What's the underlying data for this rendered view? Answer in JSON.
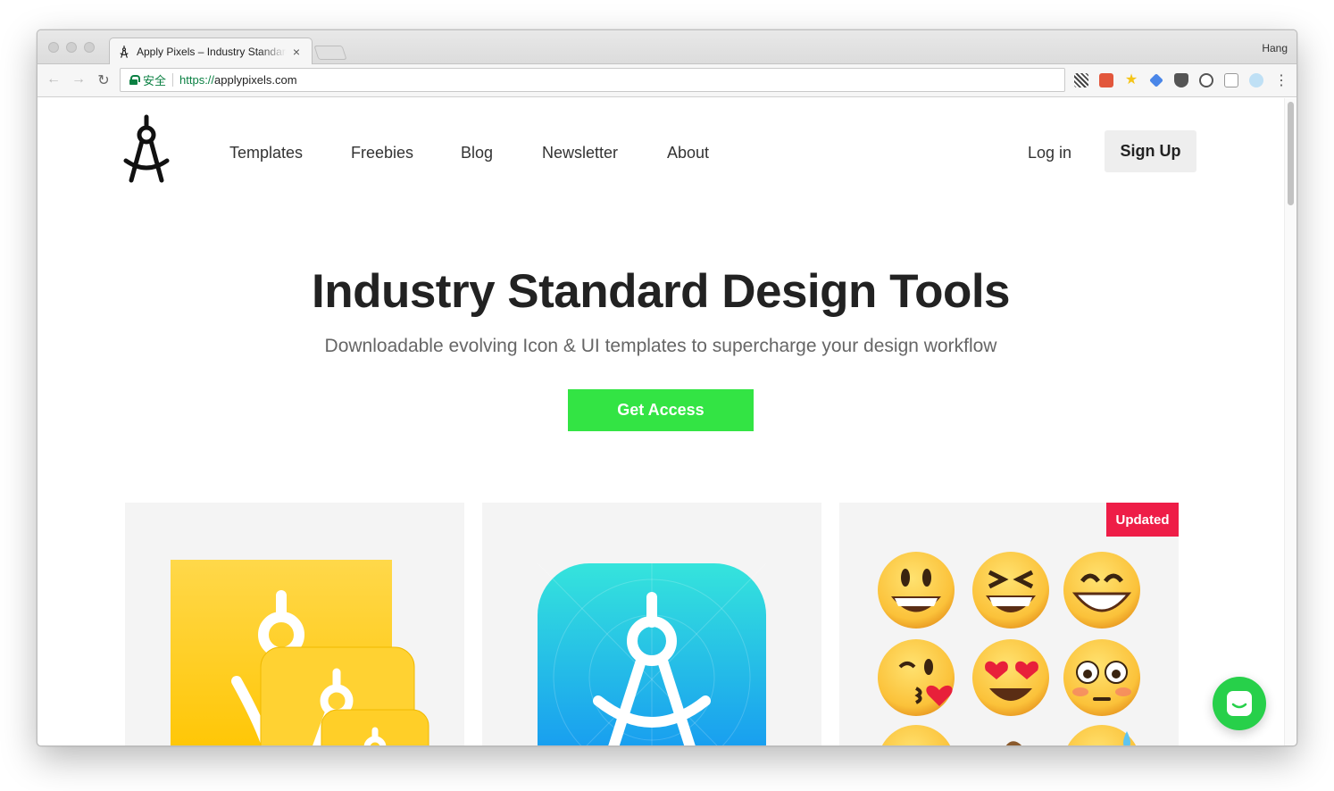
{
  "browser": {
    "tab_title": "Apply Pixels – Industry Standard Design Tools",
    "tab_close": "×",
    "profile_name": "Hang",
    "secure_label": "安全",
    "url_scheme": "https://",
    "url_host": "applypixels.com",
    "back_icon": "←",
    "forward_icon": "→",
    "reload_icon": "↻",
    "menu_icon": "⋮"
  },
  "nav": {
    "links": [
      "Templates",
      "Freebies",
      "Blog",
      "Newsletter",
      "About"
    ],
    "login": "Log in",
    "signup": "Sign Up"
  },
  "hero": {
    "title_regular": "Industry Standard ",
    "title_bold": "Design Tools",
    "subtitle": "Downloadable evolving Icon & UI templates to supercharge your design workflow",
    "cta": "Get Access"
  },
  "cards": {
    "badge": "Updated"
  },
  "colors": {
    "cta_green": "#33e444",
    "badge_red": "#ee1d47",
    "chat_green": "#27d04a",
    "secure_green": "#0b8043"
  },
  "icons": [
    "compass-logo-icon",
    "lock-icon",
    "chat-icon",
    "emoji-icon"
  ]
}
